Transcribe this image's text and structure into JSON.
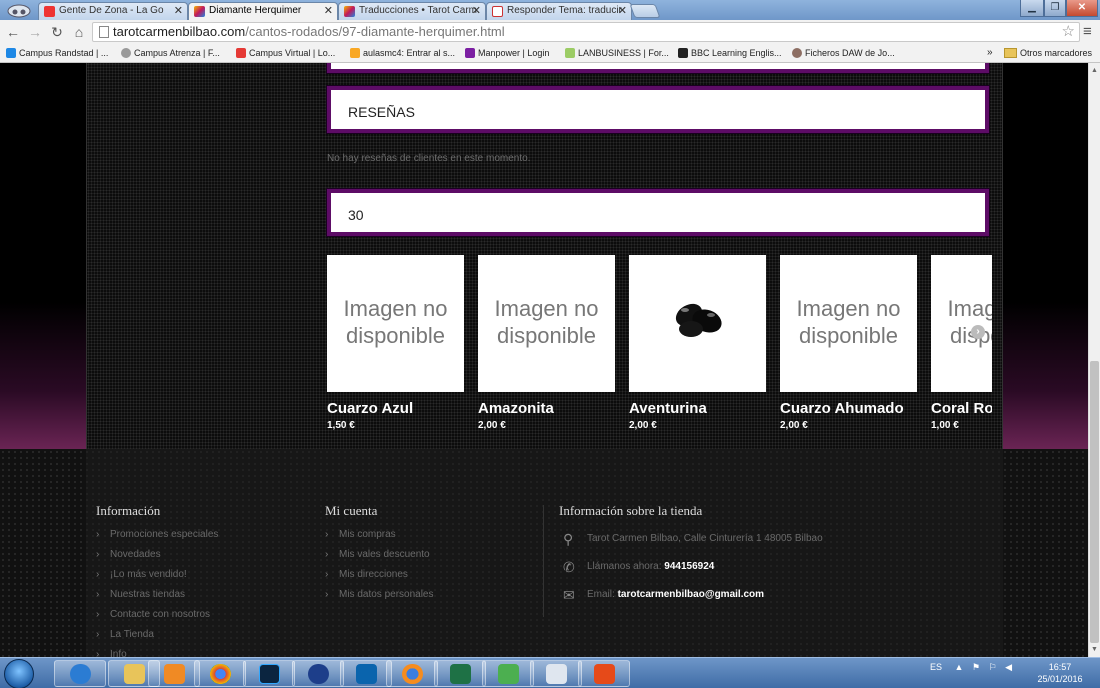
{
  "browser": {
    "tabs": [
      {
        "label": "Gente De Zona - La Go",
        "color": "#e33"
      },
      {
        "label": "Diamante Herquimer",
        "color": "#c2185b"
      },
      {
        "label": "Traducciones • Tarot Carm",
        "color": "#c2185b"
      },
      {
        "label": "Responder Tema: traducir",
        "color": "#ffffff"
      }
    ],
    "url_host": "tarotcarmenbilbao.com",
    "url_path": "/cantos-rodados/97-diamante-herquimer.html",
    "bookmarks": [
      "Campus Randstad | ...",
      "Campus Atrenza | F...",
      "Campus Virtual | Lo...",
      "aulasmc4: Entrar al s...",
      "Manpower | Login",
      "LANBUSINESS | For...",
      "BBC Learning Englis...",
      "Ficheros DAW de Jo..."
    ],
    "bookmarks_more": "»",
    "other_bookmarks": "Otros marcadores"
  },
  "page": {
    "reviews_title": "RESEÑAS",
    "no_reviews_text": "No hay reseñas de clientes en este momento.",
    "count_title": "30",
    "no_image_text": "Imagen no disponible",
    "products": [
      {
        "name": "Cuarzo Azul",
        "price": "1,50 €",
        "has_image": false
      },
      {
        "name": "Amazonita",
        "price": "2,00 €",
        "has_image": false
      },
      {
        "name": "Aventurina",
        "price": "2,00 €",
        "has_image": true
      },
      {
        "name": "Cuarzo Ahumado",
        "price": "2,00 €",
        "has_image": false
      },
      {
        "name": "Coral Roj",
        "price": "1,00 €",
        "has_image": false
      }
    ]
  },
  "footer": {
    "info_title": "Información",
    "info_links": [
      "Promociones especiales",
      "Novedades",
      "¡Lo más vendido!",
      "Nuestras tiendas",
      "Contacte con nosotros",
      "La Tienda",
      "Info"
    ],
    "account_title": "Mi cuenta",
    "account_links": [
      "Mis compras",
      "Mis vales descuento",
      "Mis direcciones",
      "Mis datos personales"
    ],
    "store_title": "Información sobre la tienda",
    "address": "Tarot Carmen Bilbao, Calle Cinturería 1 48005 Bilbao",
    "call_label": "Llámanos ahora:",
    "phone": "944156924",
    "email_label": "Email:",
    "email": "tarotcarmenbilbao@gmail.com"
  },
  "taskbar": {
    "lang": "ES",
    "time": "16:57",
    "date": "25/01/2016"
  },
  "colors": {
    "accent_border": "#5d0c66",
    "page_bg": "#000000"
  }
}
